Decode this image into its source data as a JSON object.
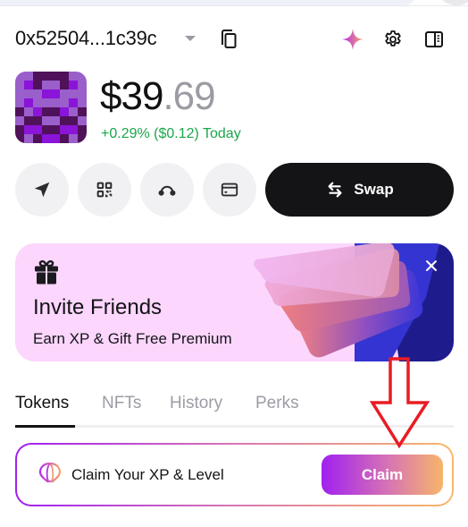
{
  "header": {
    "address": "0x52504...1c39c",
    "icons": [
      "chevron-down-icon",
      "copy-icon",
      "sparkle-icon",
      "gear-icon",
      "side-panel-icon"
    ]
  },
  "balance": {
    "integer": "$39",
    "decimal": ".69",
    "change": "+0.29% ($0.12) Today",
    "change_color": "#1aa64a"
  },
  "avatar": {
    "grid": [
      [
        0,
        0,
        2,
        2,
        2,
        2,
        0,
        0
      ],
      [
        0,
        1,
        2,
        0,
        0,
        2,
        1,
        0
      ],
      [
        0,
        0,
        0,
        1,
        1,
        0,
        0,
        0
      ],
      [
        0,
        1,
        0,
        0,
        0,
        0,
        1,
        0
      ],
      [
        2,
        0,
        1,
        2,
        2,
        1,
        0,
        2
      ],
      [
        0,
        2,
        2,
        0,
        0,
        2,
        2,
        0
      ],
      [
        2,
        1,
        1,
        2,
        2,
        1,
        1,
        2
      ],
      [
        2,
        0,
        2,
        1,
        1,
        2,
        0,
        2
      ]
    ]
  },
  "actions": [
    {
      "name": "send",
      "icon": "send-icon"
    },
    {
      "name": "receive",
      "icon": "qr-code-icon"
    },
    {
      "name": "bridge",
      "icon": "bridge-icon"
    },
    {
      "name": "buy",
      "icon": "card-icon"
    }
  ],
  "swap": {
    "label": "Swap",
    "icon": "swap-arrows-icon"
  },
  "banner": {
    "title": "Invite Friends",
    "subtitle": "Earn XP & Gift Free Premium",
    "icon": "gift-icon",
    "background": "#fcd6fd"
  },
  "tabs": [
    {
      "label": "Tokens",
      "active": true
    },
    {
      "label": "NFTs",
      "active": false
    },
    {
      "label": "History",
      "active": false
    },
    {
      "label": "Perks",
      "active": false
    }
  ],
  "claim": {
    "text": "Claim Your XP & Level",
    "button": "Claim",
    "icon": "balloon-icon"
  },
  "colors": {
    "accent_gradient_start": "#a020f0",
    "accent_gradient_end": "#f8b76a",
    "dark": "#141417",
    "annotation": "#e81c24"
  }
}
